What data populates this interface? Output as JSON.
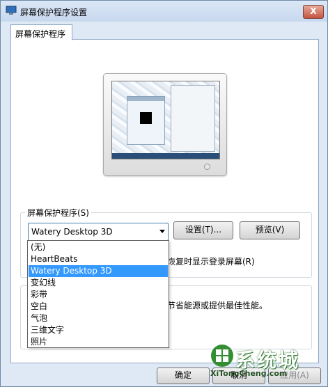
{
  "window": {
    "title": "屏幕保护程序设置",
    "close_glyph": "X"
  },
  "tabs": [
    {
      "label": "屏幕保护程序"
    }
  ],
  "screensaver": {
    "group_label": "屏幕保护程序(S)",
    "selected": "Watery Desktop 3D",
    "settings_label": "设置(T)...",
    "preview_label": "预览(V)",
    "options": [
      "(无)",
      "HeartBeats",
      "Watery Desktop 3D",
      "变幻线",
      "彩带",
      "空白",
      "气泡",
      "三维文字",
      "照片"
    ],
    "selected_index": 2,
    "resume_text_partial": "恢复时显示登录屏幕(R)"
  },
  "power": {
    "text_partial": "节省能源或提供最佳性能。"
  },
  "footer": {
    "ok_label": "确定",
    "cancel_label": "取消",
    "apply_label": "应用(A)"
  },
  "watermark": {
    "text": "系统城",
    "site": "XiTongCheng.com"
  },
  "colors": {
    "selection": "#3399ff",
    "watermark_green": "#2a8a2a"
  }
}
